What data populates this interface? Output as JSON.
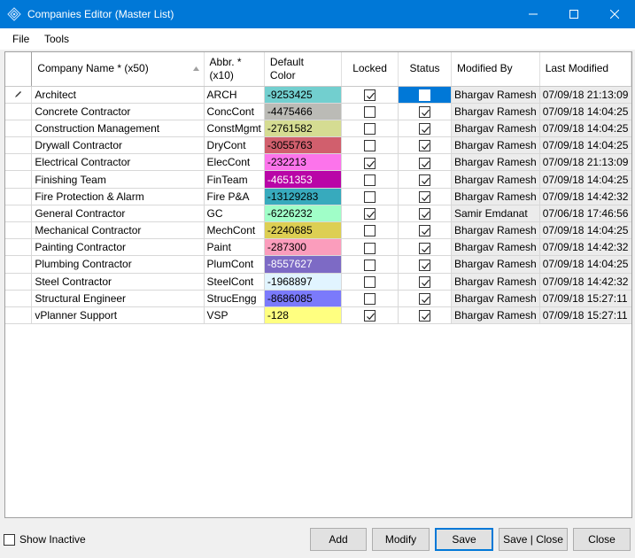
{
  "window": {
    "title": "Companies Editor (Master List)",
    "controls": {
      "minimize": "minimize",
      "maximize": "maximize",
      "close": "close"
    }
  },
  "menu": {
    "file": "File",
    "tools": "Tools"
  },
  "grid": {
    "columns": {
      "company": "Company Name * (x50)",
      "abbr_line1": "Abbr. *",
      "abbr_line2": "(x10)",
      "color_line1": "Default",
      "color_line2": "Color",
      "locked": "Locked",
      "status": "Status",
      "modified_by": "Modified By",
      "last_modified": "Last Modified"
    },
    "rows": [
      {
        "company": "Architect",
        "abbr": "ARCH",
        "color": "-9253425",
        "color_hex": "#72cfcf",
        "text_color": "#000",
        "locked": true,
        "status": false,
        "modified_by": "Bhargav Ramesh",
        "last_modified": "07/09/18 21:13:09"
      },
      {
        "company": "Concrete Contractor",
        "abbr": "ConcCont",
        "color": "-4475466",
        "color_hex": "#bbbbb6",
        "text_color": "#000",
        "locked": false,
        "status": true,
        "modified_by": "Bhargav Ramesh",
        "last_modified": "07/09/18 14:04:25"
      },
      {
        "company": "Construction Management",
        "abbr": "ConstMgmt",
        "color": "-2761582",
        "color_hex": "#d5dc92",
        "text_color": "#000",
        "locked": false,
        "status": true,
        "modified_by": "Bhargav Ramesh",
        "last_modified": "07/09/18 14:04:25"
      },
      {
        "company": "Drywall Contractor",
        "abbr": "DryCont",
        "color": "-3055763",
        "color_hex": "#d15f6d",
        "text_color": "#000",
        "locked": false,
        "status": true,
        "modified_by": "Bhargav Ramesh",
        "last_modified": "07/09/18 14:04:25"
      },
      {
        "company": "Electrical Contractor",
        "abbr": "ElecCont",
        "color": "-232213",
        "color_hex": "#fc74eb",
        "text_color": "#000",
        "locked": true,
        "status": true,
        "modified_by": "Bhargav Ramesh",
        "last_modified": "07/09/18 21:13:09"
      },
      {
        "company": "Finishing Team",
        "abbr": "FinTeam",
        "color": "-4651353",
        "color_hex": "#b906a7",
        "text_color": "#fff",
        "locked": false,
        "status": true,
        "modified_by": "Bhargav Ramesh",
        "last_modified": "07/09/18 14:04:25"
      },
      {
        "company": "Fire Protection & Alarm",
        "abbr": "Fire P&A",
        "color": "-13129283",
        "color_hex": "#37aabd",
        "text_color": "#000",
        "locked": false,
        "status": true,
        "modified_by": "Bhargav Ramesh",
        "last_modified": "07/09/18 14:42:32"
      },
      {
        "company": "General Contractor",
        "abbr": "GC",
        "color": "-6226232",
        "color_hex": "#a0fec8",
        "text_color": "#000",
        "locked": true,
        "status": true,
        "modified_by": "Samir Emdanat",
        "last_modified": "07/06/18 17:46:56"
      },
      {
        "company": "Mechanical Contractor",
        "abbr": "MechCont",
        "color": "-2240685",
        "color_hex": "#ddcf53",
        "text_color": "#000",
        "locked": false,
        "status": true,
        "modified_by": "Bhargav Ramesh",
        "last_modified": "07/09/18 14:04:25"
      },
      {
        "company": "Painting Contractor",
        "abbr": "Paint",
        "color": "-287300",
        "color_hex": "#fb9dbc",
        "text_color": "#000",
        "locked": false,
        "status": true,
        "modified_by": "Bhargav Ramesh",
        "last_modified": "07/09/18 14:42:32"
      },
      {
        "company": "Plumbing Contractor",
        "abbr": "PlumCont",
        "color": "-8557627",
        "color_hex": "#7d6ac5",
        "text_color": "#fff",
        "locked": false,
        "status": true,
        "modified_by": "Bhargav Ramesh",
        "last_modified": "07/09/18 14:04:25"
      },
      {
        "company": "Steel Contractor",
        "abbr": "SteelCont",
        "color": "-1968897",
        "color_hex": "#e1f4ff",
        "text_color": "#000",
        "locked": false,
        "status": true,
        "modified_by": "Bhargav Ramesh",
        "last_modified": "07/09/18 14:42:32"
      },
      {
        "company": "Structural Engineer",
        "abbr": "StrucEngg",
        "color": "-8686085",
        "color_hex": "#7b7afb",
        "text_color": "#000",
        "locked": false,
        "status": true,
        "modified_by": "Bhargav Ramesh",
        "last_modified": "07/09/18 15:27:11"
      },
      {
        "company": "vPlanner Support",
        "abbr": "VSP",
        "color": "-128",
        "color_hex": "#ffff80",
        "text_color": "#000",
        "locked": true,
        "status": true,
        "modified_by": "Bhargav Ramesh",
        "last_modified": "07/09/18 15:27:11"
      }
    ]
  },
  "footer": {
    "show_inactive": "Show Inactive",
    "show_inactive_checked": false,
    "buttons": {
      "add": "Add",
      "modify": "Modify",
      "save": "Save",
      "save_close": "Save | Close",
      "close": "Close"
    }
  },
  "colors": {
    "titlebar": "#0078d7",
    "selection": "#0078d7",
    "modified_gray": "#ececec"
  },
  "icons": {
    "app": "diamond-app-icon",
    "row_edit": "pencil-icon",
    "sort": "sort-ascending-icon"
  }
}
